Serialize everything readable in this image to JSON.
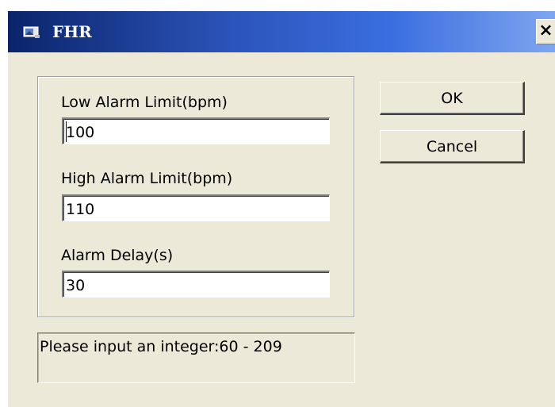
{
  "window": {
    "title": "FHR",
    "close_label": "×",
    "title_icon": "dialog-icon"
  },
  "fields": {
    "low_alarm": {
      "label": "Low Alarm Limit(bpm)",
      "value": "100"
    },
    "high_alarm": {
      "label": "High Alarm Limit(bpm)",
      "value": "110"
    },
    "alarm_delay": {
      "label": "Alarm Delay(s)",
      "value": "30"
    }
  },
  "buttons": {
    "ok_label": "OK",
    "cancel_label": "Cancel"
  },
  "status": {
    "message": "Please input an integer:60 - 209"
  },
  "colors": {
    "titlebar_start": "#0a246a",
    "titlebar_end": "#7fa5f0",
    "dialog_bg": "#ece9d8"
  }
}
